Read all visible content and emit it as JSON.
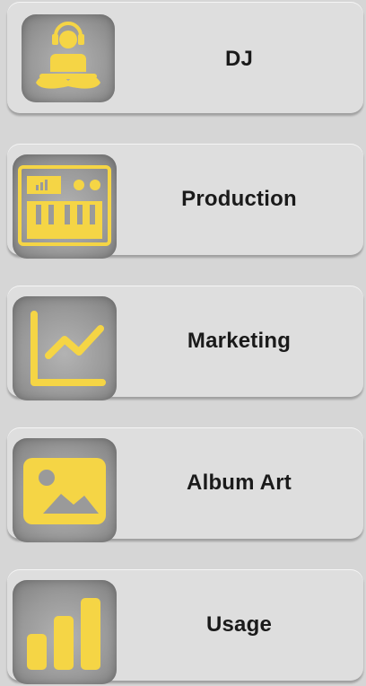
{
  "menu": {
    "items": [
      {
        "label": "DJ",
        "icon": "dj-icon"
      },
      {
        "label": "Production",
        "icon": "production-icon"
      },
      {
        "label": "Marketing",
        "icon": "marketing-icon"
      },
      {
        "label": "Album Art",
        "icon": "album-art-icon"
      },
      {
        "label": "Usage",
        "icon": "usage-icon"
      }
    ]
  },
  "colors": {
    "accent": "#f5d545",
    "card": "#dedede",
    "background": "#d6d6d6",
    "text": "#1a1a1a"
  }
}
